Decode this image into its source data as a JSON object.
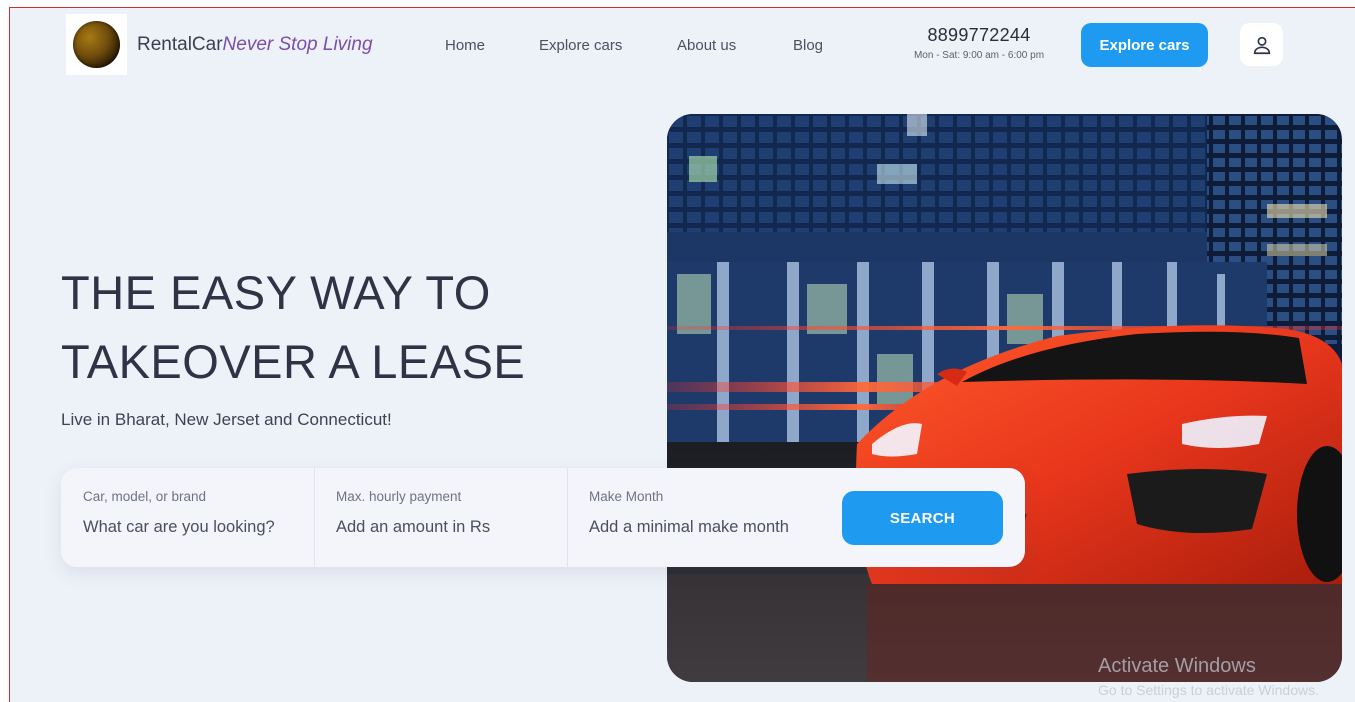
{
  "brand": {
    "name": "RentalCar",
    "tagline": "Never Stop Living"
  },
  "nav": {
    "items": [
      {
        "label": "Home"
      },
      {
        "label": "Explore cars"
      },
      {
        "label": "About us"
      },
      {
        "label": "Blog"
      }
    ]
  },
  "contact": {
    "phone": "8899772244",
    "hours": "Mon - Sat: 9:00 am - 6:00 pm"
  },
  "header": {
    "cta_label": "Explore cars",
    "user_icon": "user-icon"
  },
  "hero": {
    "title_line1": "THE EASY WAY TO",
    "title_line2": "TAKEOVER A LEASE",
    "subtitle": "Live in Bharat, New Jerset and Connecticut!"
  },
  "search": {
    "fields": [
      {
        "label": "Car, model, or brand",
        "placeholder": "What car are you looking?"
      },
      {
        "label": "Max. hourly payment",
        "placeholder": "Add an amount in Rs"
      },
      {
        "label": "Make Month",
        "placeholder": "Add a minimal make month"
      }
    ],
    "button_label": "SEARCH"
  },
  "watermark": {
    "line1": "Activate Windows",
    "line2": "Go to Settings to activate Windows."
  },
  "colors": {
    "accent": "#1e9bf0",
    "background": "#edf1f8",
    "tagline": "#7b4fa8",
    "car": "#e8361c"
  }
}
